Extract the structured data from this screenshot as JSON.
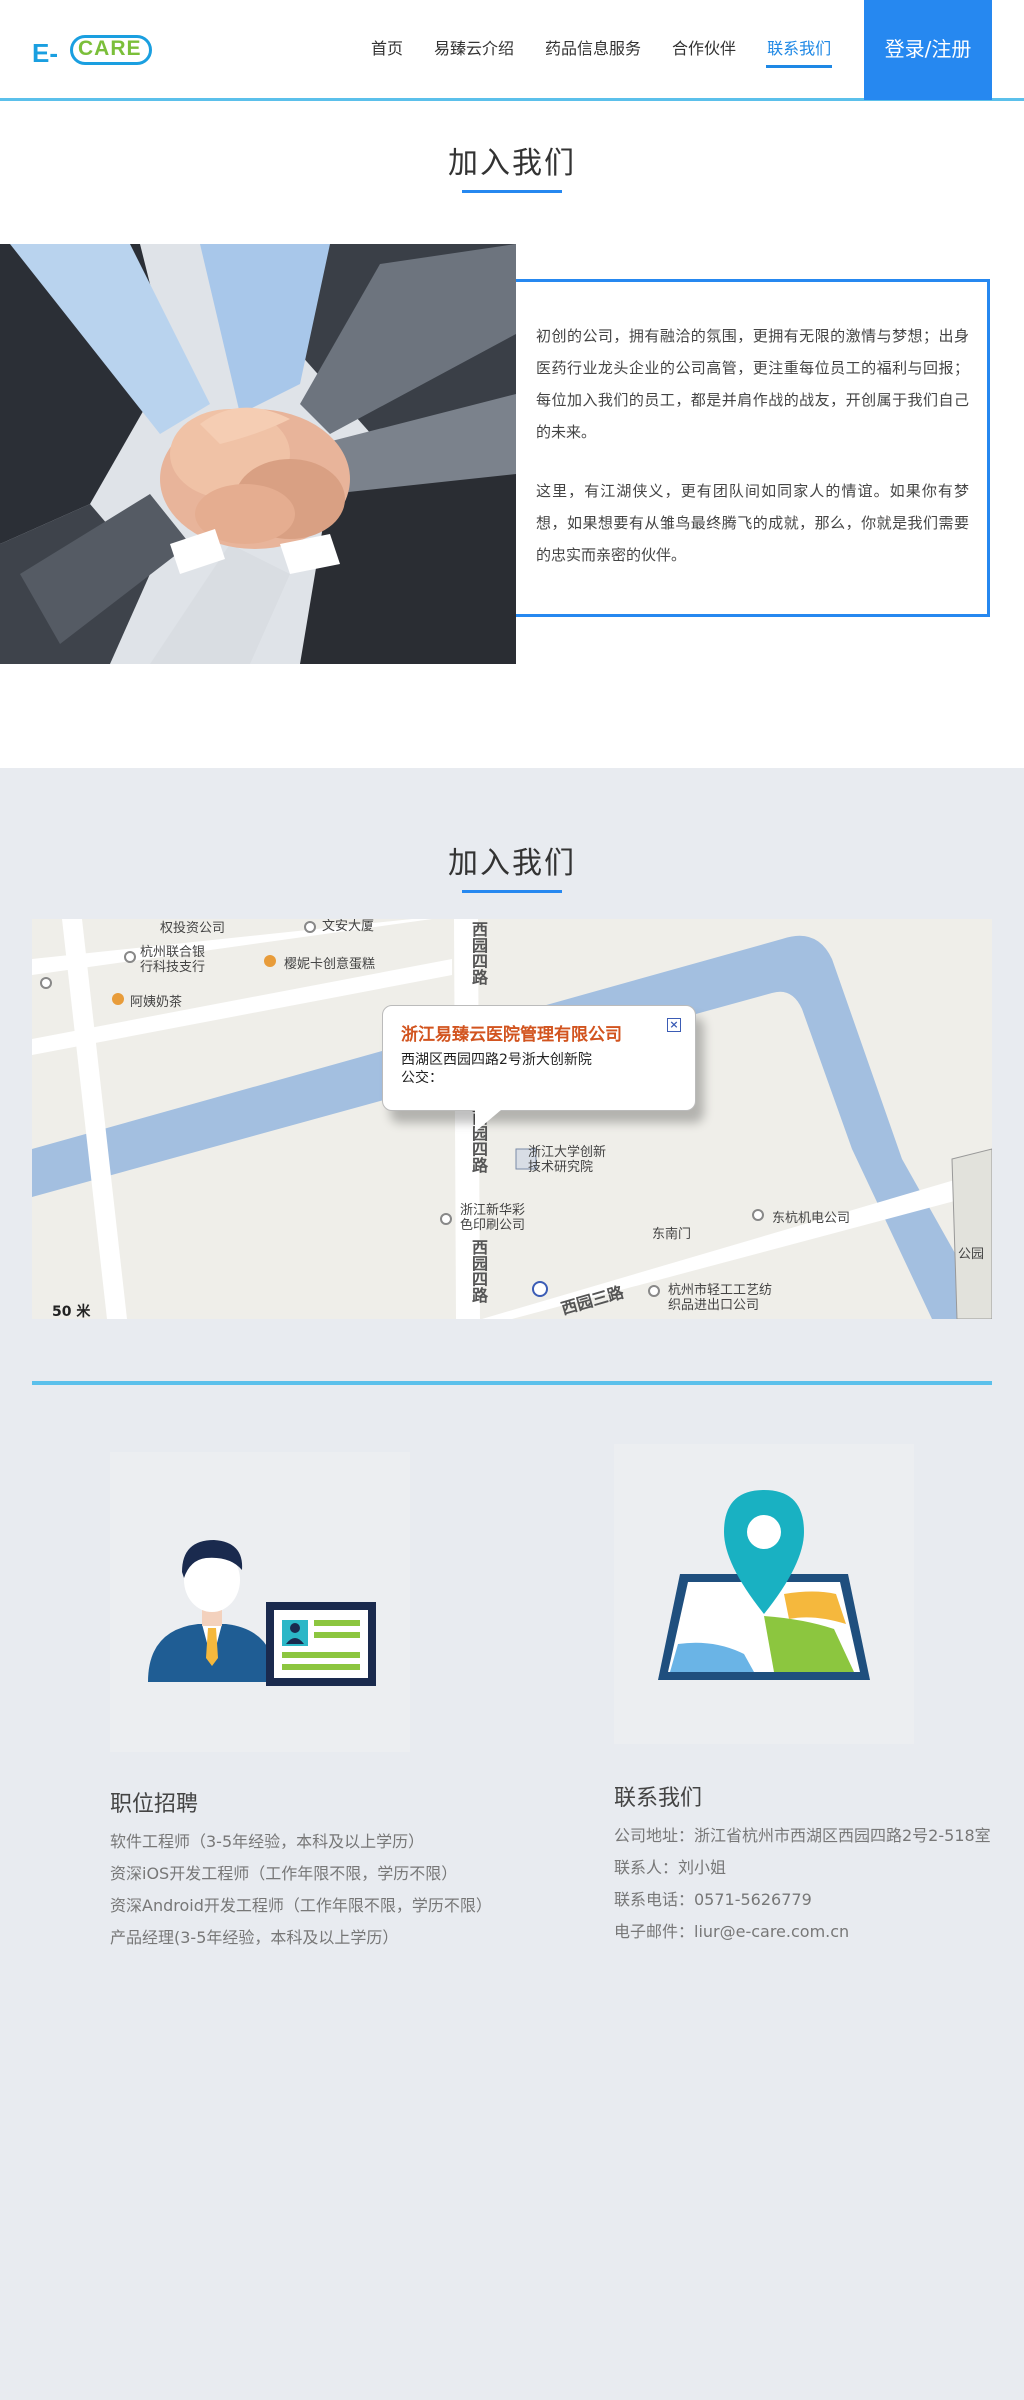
{
  "header": {
    "logo": {
      "prefix": "E-",
      "pill": "CARE"
    },
    "nav": [
      "首页",
      "易臻云介绍",
      "药品信息服务",
      "合作伙伴",
      "联系我们"
    ],
    "active_index": 4,
    "login_label": "登录/注册",
    "accent": "#2688f0"
  },
  "join": {
    "title": "加入我们",
    "paragraphs": [
      "初创的公司，拥有融洽的氛围，更拥有无限的激情与梦想；出身医药行业龙头企业的公司高管，更注重每位员工的福利与回报；每位加入我们的员工，都是并肩作战的战友，开创属于我们自己的未来。",
      "这里，有江湖侠义，更有团队间如同家人的情谊。如果你有梦想，如果想要有从雏鸟最终腾飞的成就，那么，你就是我们需要的忠实而亲密的伙伴。"
    ]
  },
  "location": {
    "title": "加入我们",
    "map": {
      "popup_title": "浙江易臻云医院管理有限公司",
      "popup_address": "西湖区西园四路2号浙大创新院",
      "popup_bus": "公交：",
      "close": "×",
      "labels": {
        "invest": "权投资公司",
        "wenan": "文安大厦",
        "bank": "杭州联合银\n行科技支行",
        "cake": "樱妮卡创意蛋糕",
        "milktea": "阿姨奶茶",
        "institute": "浙江大学创新\n技术研究院",
        "printing": "浙江新华彩\n色印刷公司",
        "dongnanmen": "东南门",
        "dongfang": "东杭机电公司",
        "light_industry": "杭州市轻工工艺纺\n织品进出口公司",
        "park": "公园",
        "road_xiyuan4_top": "西园四路",
        "road_xiyuan4_mid": "西园四路",
        "road_xiyuan4_low": "西园四路",
        "road_xiyuan3": "西园三路"
      },
      "scale": "50 米"
    }
  },
  "jobs": {
    "title": "职位招聘",
    "items": [
      "软件工程师（3-5年经验，本科及以上学历）",
      "资深iOS开发工程师（工作年限不限，学历不限）",
      "资深Android开发工程师（工作年限不限，学历不限）",
      "产品经理(3-5年经验，本科及以上学历）"
    ]
  },
  "contact": {
    "title": "联系我们",
    "items": [
      "公司地址：浙江省杭州市西湖区西园四路2号2-518室",
      "联系人：刘小姐",
      "联系电话：0571-5626779",
      "电子邮件：liur@e-care.com.cn"
    ]
  }
}
